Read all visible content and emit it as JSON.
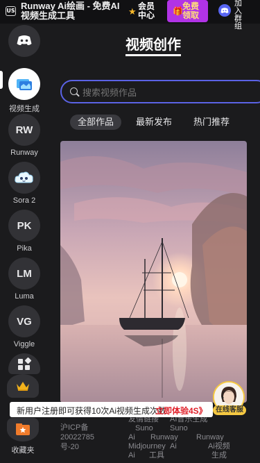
{
  "header": {
    "logo_badge": "US",
    "title": "Runway Ai绘画 - 免费AI视频生成工具",
    "vip_label": "会员中心",
    "gift_label": "免费领取",
    "discord_label": "加入群组"
  },
  "sidebar": {
    "items": [
      {
        "label": "",
        "icon": "discord-icon"
      },
      {
        "label": "视频生成",
        "icon": "video-folder-icon"
      },
      {
        "label": "Runway",
        "abbr": "RW"
      },
      {
        "label": "Sora 2",
        "icon": "cloud-face-icon"
      },
      {
        "label": "Pika",
        "abbr": "PK"
      },
      {
        "label": "Luma",
        "abbr": "LM"
      },
      {
        "label": "Viggle",
        "abbr": "VG"
      },
      {
        "label": "",
        "icon": "apps-grid-icon"
      }
    ],
    "bottom_app_label": "收藏夹"
  },
  "main": {
    "page_title": "视频创作",
    "search": {
      "value": "",
      "placeholder": "搜索视频作品"
    },
    "tabs": [
      {
        "label": "全部作品",
        "active": true
      },
      {
        "label": "最新发布",
        "active": false
      },
      {
        "label": "热门推荐",
        "active": false
      }
    ]
  },
  "banner": {
    "text": "新用户注册即可获得10次Ai视频生成次数",
    "link": "立即体验4S》"
  },
  "customer_service": {
    "label": "在线客服"
  },
  "footer": {
    "icp": "沪ICP备",
    "icp_number": "20022785",
    "icp_suffix": "号-20",
    "col2": [
      "友情链接",
      "Suno",
      "Ai",
      "Midjourney",
      "Ai",
      "工具"
    ],
    "col3": [
      "AI音乐生成",
      "Suno",
      "Runway",
      "Ai"
    ],
    "col4": [
      "Runway",
      "Ai视频",
      "生成"
    ]
  },
  "colors": {
    "background": "#1b1b1d",
    "accent": "#5b63e6",
    "gift": "#b133e6",
    "discord": "#5865f2"
  }
}
